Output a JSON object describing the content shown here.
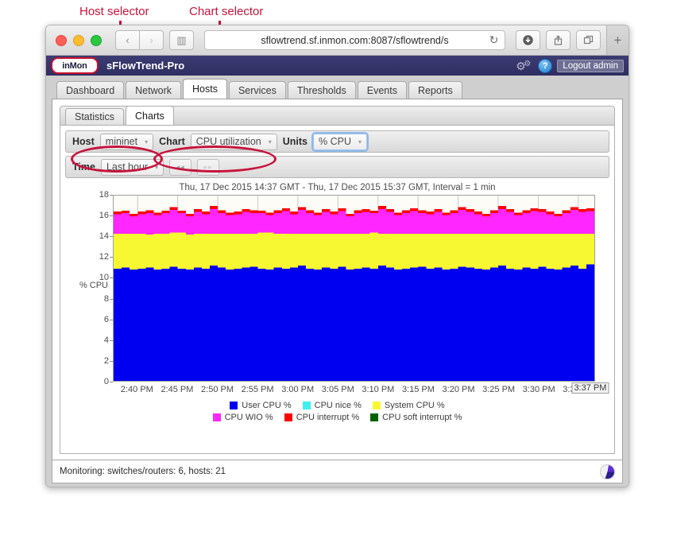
{
  "annotations": [
    {
      "id": "host",
      "label": "Host selector"
    },
    {
      "id": "chart",
      "label": "Chart selector"
    }
  ],
  "browser": {
    "url_main": "sflowtrend.sf.inmon.com:8087/sflowtrend/s",
    "url_tail": "",
    "reload_icon": "↻",
    "back_icon": "‹",
    "forward_icon": "›",
    "sidebar_icon": "▥",
    "download_icon": "⬇",
    "share_icon": "⤴",
    "tabs_icon": "⧉",
    "newtab_icon": "+"
  },
  "app": {
    "logo_text": "inMon",
    "title": "sFlowTrend-Pro",
    "help_glyph": "?",
    "logout_label": "Logout admin"
  },
  "main_tabs": [
    {
      "label": "Dashboard",
      "active": false
    },
    {
      "label": "Network",
      "active": false
    },
    {
      "label": "Hosts",
      "active": true
    },
    {
      "label": "Services",
      "active": false
    },
    {
      "label": "Thresholds",
      "active": false
    },
    {
      "label": "Events",
      "active": false
    },
    {
      "label": "Reports",
      "active": false
    }
  ],
  "sub_tabs": [
    {
      "label": "Statistics",
      "active": false
    },
    {
      "label": "Charts",
      "active": true
    }
  ],
  "controls": {
    "row1": {
      "host_label": "Host",
      "host_value": "mininet",
      "chart_label": "Chart",
      "chart_value": "CPU utilization",
      "units_label": "Units",
      "units_value": "% CPU"
    },
    "row2": {
      "time_label": "Time",
      "time_value": "Last hour",
      "prev_label": "◂◂",
      "next_label": "▸▸"
    },
    "caret": "▾"
  },
  "status": {
    "text": "Monitoring: switches/routers: 6, hosts: 21"
  },
  "chart_data": {
    "type": "area",
    "title": "Thu, 17 Dec 2015 14:37 GMT - Thu, 17 Dec 2015 15:37 GMT, Interval = 1 min",
    "xlabel": "",
    "ylabel": "% CPU",
    "ylim": [
      0,
      18
    ],
    "yticks": [
      0,
      2,
      4,
      6,
      8,
      10,
      12,
      14,
      16,
      18
    ],
    "xticks": [
      "2:40 PM",
      "2:45 PM",
      "2:50 PM",
      "2:55 PM",
      "3:00 PM",
      "3:05 PM",
      "3:10 PM",
      "3:15 PM",
      "3:20 PM",
      "3:25 PM",
      "3:30 PM",
      "3:35 PM"
    ],
    "x_tooltip": "3:37 PM",
    "grid": true,
    "stacked": true,
    "legend_position": "bottom",
    "colors": {
      "user_cpu": "#0000f0",
      "cpu_nice": "#3ff0f0",
      "system_cpu": "#f8f832",
      "cpu_wio": "#ff26ff",
      "cpu_interrupt": "#ff0000",
      "cpu_soft_interrupt": "#006400"
    },
    "series": [
      {
        "name": "User CPU %",
        "color": "#0000f0",
        "values": [
          10.9,
          11.0,
          10.8,
          10.9,
          11.0,
          10.8,
          10.9,
          11.1,
          10.9,
          10.8,
          11.0,
          10.9,
          11.2,
          11.0,
          10.8,
          10.9,
          11.0,
          11.1,
          10.9,
          10.8,
          11.0,
          10.9,
          11.0,
          11.2,
          10.9,
          10.8,
          11.0,
          10.9,
          11.1,
          10.8,
          10.9,
          11.0,
          10.9,
          11.2,
          11.0,
          10.8,
          10.9,
          11.0,
          11.1,
          10.9,
          11.0,
          10.8,
          10.9,
          11.1,
          11.0,
          10.9,
          10.8,
          11.0,
          11.2,
          10.9,
          10.8,
          11.0,
          10.9,
          11.1,
          10.9,
          10.8,
          11.0,
          11.2,
          10.9,
          11.3
        ]
      },
      {
        "name": "CPU nice %",
        "color": "#3ff0f0",
        "values": [
          0,
          0,
          0,
          0,
          0,
          0,
          0,
          0,
          0,
          0,
          0,
          0,
          0,
          0,
          0,
          0,
          0,
          0,
          0,
          0,
          0,
          0,
          0,
          0,
          0,
          0,
          0,
          0,
          0,
          0,
          0,
          0,
          0,
          0,
          0,
          0,
          0,
          0,
          0,
          0,
          0,
          0,
          0,
          0,
          0,
          0,
          0,
          0,
          0,
          0,
          0,
          0,
          0,
          0,
          0,
          0,
          0,
          0,
          0,
          0
        ]
      },
      {
        "name": "System CPU %",
        "color": "#f8f832",
        "values": [
          3.4,
          3.3,
          3.5,
          3.4,
          3.2,
          3.5,
          3.4,
          3.3,
          3.5,
          3.4,
          3.3,
          3.4,
          3.1,
          3.3,
          3.5,
          3.4,
          3.3,
          3.2,
          3.5,
          3.6,
          3.3,
          3.4,
          3.3,
          3.1,
          3.4,
          3.5,
          3.3,
          3.4,
          3.2,
          3.5,
          3.4,
          3.3,
          3.5,
          3.1,
          3.3,
          3.5,
          3.4,
          3.3,
          3.2,
          3.4,
          3.3,
          3.5,
          3.4,
          3.2,
          3.3,
          3.4,
          3.5,
          3.3,
          3.1,
          3.4,
          3.5,
          3.3,
          3.4,
          3.2,
          3.4,
          3.5,
          3.3,
          3.1,
          3.4,
          3.0
        ]
      },
      {
        "name": "CPU WIO %",
        "color": "#ff26ff",
        "values": [
          1.9,
          2.0,
          1.7,
          1.9,
          2.1,
          1.8,
          2.0,
          2.2,
          1.9,
          1.8,
          2.1,
          1.9,
          2.4,
          2.0,
          1.8,
          1.9,
          2.1,
          2.0,
          1.9,
          1.7,
          2.0,
          2.2,
          1.9,
          2.3,
          2.0,
          1.8,
          2.1,
          1.9,
          2.2,
          1.7,
          2.0,
          2.1,
          1.9,
          2.4,
          2.1,
          1.8,
          2.0,
          2.2,
          2.0,
          1.9,
          2.1,
          1.8,
          2.0,
          2.3,
          2.1,
          1.9,
          1.7,
          2.0,
          2.4,
          2.1,
          1.8,
          2.0,
          2.2,
          2.1,
          1.9,
          1.7,
          2.0,
          2.3,
          2.1,
          2.2
        ]
      },
      {
        "name": "CPU interrupt %",
        "color": "#ff0000",
        "values": [
          0.25,
          0.25,
          0.22,
          0.25,
          0.27,
          0.23,
          0.25,
          0.28,
          0.25,
          0.23,
          0.27,
          0.25,
          0.3,
          0.26,
          0.23,
          0.25,
          0.27,
          0.26,
          0.25,
          0.22,
          0.26,
          0.28,
          0.25,
          0.29,
          0.26,
          0.23,
          0.27,
          0.25,
          0.28,
          0.22,
          0.26,
          0.27,
          0.25,
          0.3,
          0.27,
          0.23,
          0.26,
          0.28,
          0.26,
          0.25,
          0.27,
          0.23,
          0.26,
          0.29,
          0.27,
          0.25,
          0.22,
          0.26,
          0.3,
          0.27,
          0.23,
          0.26,
          0.28,
          0.27,
          0.25,
          0.22,
          0.26,
          0.29,
          0.27,
          0.28
        ]
      },
      {
        "name": "CPU soft interrupt %",
        "color": "#006400",
        "values": [
          0,
          0,
          0,
          0,
          0,
          0,
          0,
          0,
          0,
          0,
          0,
          0,
          0,
          0,
          0,
          0,
          0,
          0,
          0,
          0,
          0,
          0,
          0,
          0,
          0,
          0,
          0,
          0,
          0,
          0,
          0,
          0,
          0,
          0,
          0,
          0,
          0,
          0,
          0,
          0,
          0,
          0,
          0,
          0,
          0,
          0,
          0,
          0,
          0,
          0,
          0,
          0,
          0,
          0,
          0,
          0,
          0,
          0,
          0,
          0
        ]
      }
    ]
  }
}
